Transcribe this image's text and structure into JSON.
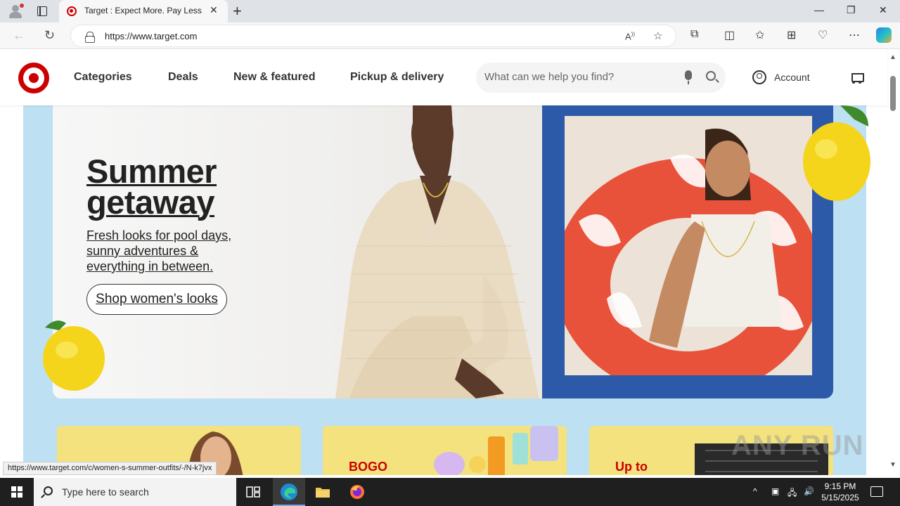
{
  "browser": {
    "tab_title": "Target : Expect More. Pay Less.",
    "url": "https://www.target.com",
    "new_tab_glyph": "+",
    "close_tab_glyph": "✕",
    "window_controls": [
      "—",
      "❐",
      "✕"
    ]
  },
  "header": {
    "nav": [
      "Categories",
      "Deals",
      "New & featured",
      "Pickup & delivery"
    ],
    "search_placeholder": "What can we help you find?",
    "account_label": "Account"
  },
  "hero": {
    "title_line1": "Summer",
    "title_line2": "getaway",
    "subtitle": "Fresh looks for pool days, sunny adventures & everything in between.",
    "cta": "Shop women's looks"
  },
  "tiles": [
    {
      "label": ""
    },
    {
      "label": "BOGO"
    },
    {
      "label": "Up to"
    }
  ],
  "status_link": "https://www.target.com/c/women-s-summer-outfits/-/N-k7jvx",
  "watermark": "ANY RUN",
  "taskbar": {
    "search_text": "Type here to search",
    "time": "9:15 PM",
    "date": "5/15/2025"
  },
  "colors": {
    "target_red": "#cc0000",
    "hero_blue": "#2d5aa8",
    "page_bg_blue": "#bde0f2",
    "tile_yellow": "#f3e27e"
  }
}
